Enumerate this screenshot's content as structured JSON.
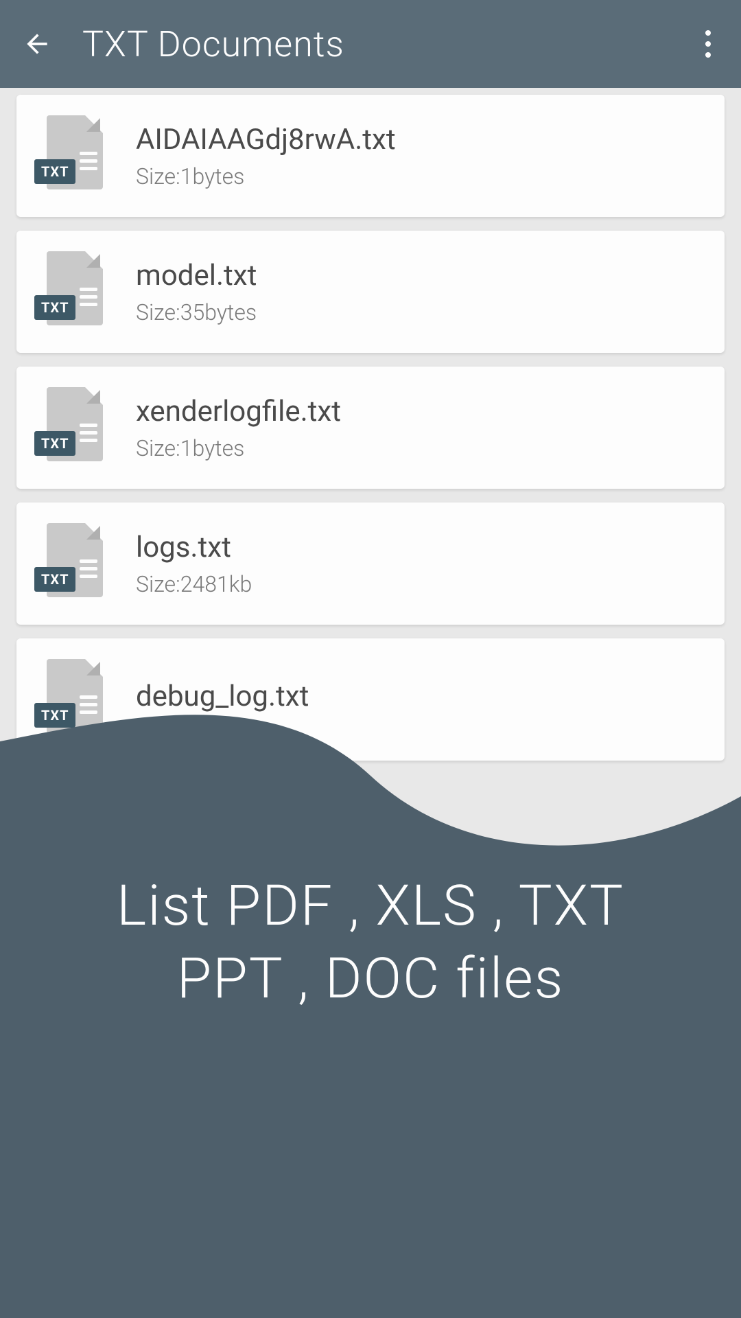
{
  "header": {
    "title": "TXT Documents"
  },
  "files": [
    {
      "name": "AIDAIAAGdj8rwA.txt",
      "size": "Size:1bytes",
      "badge": "TXT"
    },
    {
      "name": "model.txt",
      "size": "Size:35bytes",
      "badge": "TXT"
    },
    {
      "name": "xenderlogfile.txt",
      "size": "Size:1bytes",
      "badge": "TXT"
    },
    {
      "name": "logs.txt",
      "size": "Size:2481kb",
      "badge": "TXT"
    },
    {
      "name": "debug_log.txt",
      "size": "",
      "badge": "TXT"
    }
  ],
  "tagline": {
    "line1": "List PDF , XLS , TXT",
    "line2": "PPT , DOC files"
  }
}
